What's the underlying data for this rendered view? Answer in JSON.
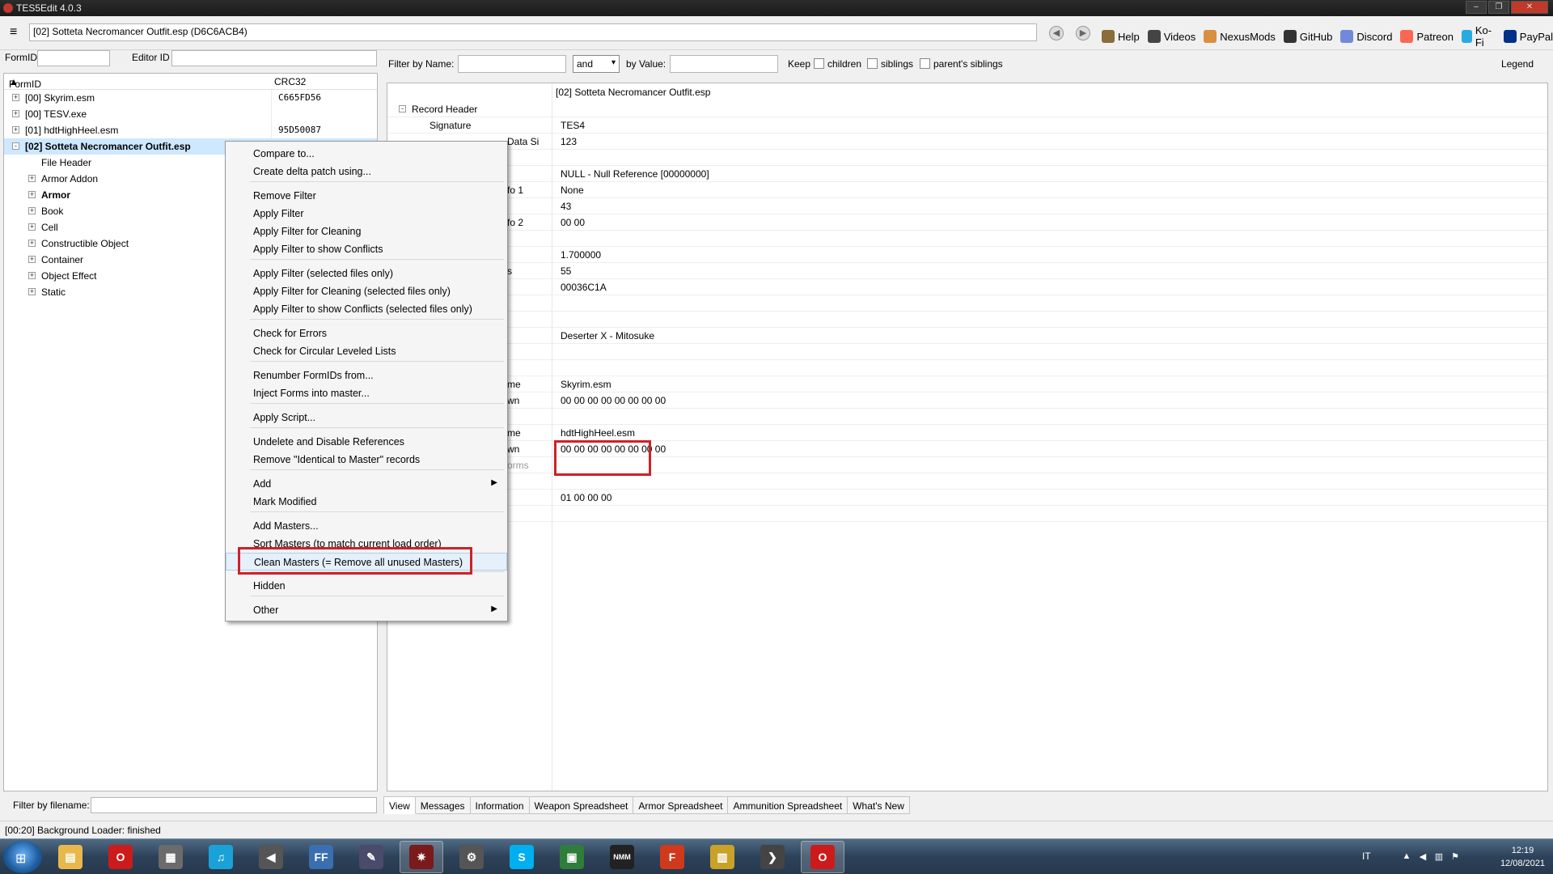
{
  "window": {
    "title": "TES5Edit 4.0.3",
    "file_path": "[02] Sotteta Necromancer Outfit.esp (D6C6ACB4)"
  },
  "toolbar": {
    "links": [
      {
        "label": "Help",
        "icon": "book-icon",
        "color": "#8a6d3b"
      },
      {
        "label": "Videos",
        "icon": "video-icon",
        "color": "#444444"
      },
      {
        "label": "NexusMods",
        "icon": "nexus-icon",
        "color": "#d98f40"
      },
      {
        "label": "GitHub",
        "icon": "github-icon",
        "color": "#333333"
      },
      {
        "label": "Discord",
        "icon": "discord-icon",
        "color": "#7289da"
      },
      {
        "label": "Patreon",
        "icon": "patreon-icon",
        "color": "#f96854"
      },
      {
        "label": "Ko-Fi",
        "icon": "kofi-icon",
        "color": "#29abe0"
      },
      {
        "label": "PayPal",
        "icon": "paypal-icon",
        "color": "#003087"
      }
    ]
  },
  "left": {
    "formid_label": "FormID",
    "editorid_label": "Editor ID",
    "tree_header": {
      "col1": "FormID",
      "col2": "CRC32"
    },
    "tree": [
      {
        "label": "[00] Skyrim.esm",
        "crc": "C665FD56",
        "level": 0,
        "exp": "+"
      },
      {
        "label": "[00] TESV.exe",
        "crc": "",
        "level": 0,
        "exp": "+"
      },
      {
        "label": "[01] hdtHighHeel.esm",
        "crc": "95D50087",
        "level": 0,
        "exp": "+"
      },
      {
        "label": "[02] Sotteta Necromancer Outfit.esp",
        "crc": "",
        "level": 0,
        "exp": "-",
        "selected": true,
        "bold": true
      },
      {
        "label": "File Header",
        "crc": "",
        "level": 1,
        "exp": ""
      },
      {
        "label": "Armor Addon",
        "crc": "",
        "level": 1,
        "exp": "+"
      },
      {
        "label": "Armor",
        "crc": "",
        "level": 1,
        "exp": "+",
        "bold": true
      },
      {
        "label": "Book",
        "crc": "",
        "level": 1,
        "exp": "+"
      },
      {
        "label": "Cell",
        "crc": "",
        "level": 1,
        "exp": "+"
      },
      {
        "label": "Constructible Object",
        "crc": "",
        "level": 1,
        "exp": "+"
      },
      {
        "label": "Container",
        "crc": "",
        "level": 1,
        "exp": "+"
      },
      {
        "label": "Object Effect",
        "crc": "",
        "level": 1,
        "exp": "+"
      },
      {
        "label": "Static",
        "crc": "",
        "level": 1,
        "exp": "+"
      }
    ],
    "filter_filename_label": "Filter by filename:"
  },
  "filter": {
    "by_name_label": "Filter by Name:",
    "operator": "and",
    "by_value_label": "by Value:",
    "keep_label": "Keep",
    "children_label": "children",
    "siblings_label": "siblings",
    "parents_siblings_label": "parent's siblings",
    "legend_label": "Legend"
  },
  "detail": {
    "header": "[02] Sotteta Necromancer Outfit.esp",
    "rows": [
      {
        "key": "Record Header",
        "value": "",
        "exp": "-",
        "indent": 0
      },
      {
        "key": "Signature",
        "value": "TES4",
        "indent": 2
      },
      {
        "key": "Data Si",
        "value": "123",
        "indent": 2
      },
      {
        "key": "",
        "value": "",
        "indent": 2
      },
      {
        "key": "",
        "value": "NULL - Null Reference [00000000]",
        "indent": 2
      },
      {
        "key": "fo 1",
        "value": "None",
        "indent": 2
      },
      {
        "key": "",
        "value": "43",
        "indent": 2
      },
      {
        "key": "fo 2",
        "value": "00 00",
        "indent": 2
      },
      {
        "key": "",
        "value": "",
        "indent": 2
      },
      {
        "key": "",
        "value": "1.700000",
        "indent": 2
      },
      {
        "key": "s",
        "value": "55",
        "indent": 2
      },
      {
        "key": "",
        "value": "00036C1A",
        "indent": 2
      },
      {
        "key": "",
        "value": "",
        "indent": 2
      },
      {
        "key": "",
        "value": "",
        "indent": 2
      },
      {
        "key": "",
        "value": "Deserter X - Mitosuke",
        "indent": 2
      },
      {
        "key": "",
        "value": "",
        "indent": 2
      },
      {
        "key": "",
        "value": "",
        "indent": 2
      },
      {
        "key": "me",
        "value": "Skyrim.esm",
        "indent": 2
      },
      {
        "key": "wn",
        "value": "00 00 00 00 00 00 00 00",
        "indent": 2
      },
      {
        "key": "",
        "value": "",
        "indent": 2
      },
      {
        "key": "me",
        "value": "hdtHighHeel.esm",
        "indent": 2
      },
      {
        "key": "wn",
        "value": "00 00 00 00 00 00 00 00",
        "indent": 2
      },
      {
        "key": "orms",
        "value": "",
        "indent": 2,
        "gray": true
      },
      {
        "key": "",
        "value": "",
        "indent": 2
      },
      {
        "key": "",
        "value": "01 00 00 00",
        "indent": 2
      },
      {
        "key": "",
        "value": "",
        "indent": 2
      }
    ]
  },
  "tabs": [
    "View",
    "Messages",
    "Information",
    "Weapon Spreadsheet",
    "Armor Spreadsheet",
    "Ammunition Spreadsheet",
    "What's New"
  ],
  "status": "[00:20] Background Loader: finished",
  "context_menu": [
    {
      "label": "Compare to..."
    },
    {
      "label": "Create delta patch using..."
    },
    {
      "sep": true
    },
    {
      "label": "Remove Filter"
    },
    {
      "label": "Apply Filter"
    },
    {
      "label": "Apply Filter for Cleaning"
    },
    {
      "label": "Apply Filter to show Conflicts"
    },
    {
      "sep": true
    },
    {
      "label": "Apply Filter (selected files only)"
    },
    {
      "label": "Apply Filter for Cleaning (selected files only)"
    },
    {
      "label": "Apply Filter to show Conflicts (selected files only)"
    },
    {
      "sep": true
    },
    {
      "label": "Check for Errors"
    },
    {
      "label": "Check for Circular Leveled Lists"
    },
    {
      "sep": true
    },
    {
      "label": "Renumber FormIDs from..."
    },
    {
      "label": "Inject Forms into master..."
    },
    {
      "sep": true
    },
    {
      "label": "Apply Script..."
    },
    {
      "sep": true
    },
    {
      "label": "Undelete and Disable References"
    },
    {
      "label": "Remove \"Identical to Master\" records"
    },
    {
      "sep": true
    },
    {
      "label": "Add",
      "submenu": true
    },
    {
      "label": "Mark Modified"
    },
    {
      "sep": true
    },
    {
      "label": "Add Masters..."
    },
    {
      "label": "Sort Masters (to match current load order)"
    },
    {
      "label": "Clean Masters (= Remove all unused Masters)",
      "highlight": true
    },
    {
      "sep": true
    },
    {
      "label": "Hidden"
    },
    {
      "sep": true
    },
    {
      "label": "Other",
      "submenu": true
    }
  ],
  "taskbar": {
    "items": [
      {
        "name": "explorer-icon",
        "color": "#e8b84a",
        "glyph": "▤"
      },
      {
        "name": "opera-icon",
        "color": "#cc1b1b",
        "glyph": "O"
      },
      {
        "name": "media-icon",
        "color": "#6b6b6b",
        "glyph": "▦"
      },
      {
        "name": "music-icon",
        "color": "#1aa2d8",
        "glyph": "♫"
      },
      {
        "name": "speaker-icon",
        "color": "#555555",
        "glyph": "◀"
      },
      {
        "name": "ffdec-icon",
        "color": "#3a6fb0",
        "glyph": "FF"
      },
      {
        "name": "pen-icon",
        "color": "#4a4a6a",
        "glyph": "✎"
      },
      {
        "name": "tes5edit-icon",
        "color": "#7a1a1a",
        "glyph": "✷",
        "active": true
      },
      {
        "name": "settings-icon",
        "color": "#555555",
        "glyph": "⚙"
      },
      {
        "name": "skype-icon",
        "color": "#00aff0",
        "glyph": "S"
      },
      {
        "name": "window-icon",
        "color": "#2f7d3a",
        "glyph": "▣"
      },
      {
        "name": "nmm-icon",
        "color": "#222222",
        "glyph": "NMM"
      },
      {
        "name": "f-icon",
        "color": "#d0391b",
        "glyph": "F"
      },
      {
        "name": "archive-icon",
        "color": "#c9a227",
        "glyph": "▥"
      },
      {
        "name": "terminal-icon",
        "color": "#444444",
        "glyph": "❯"
      },
      {
        "name": "opera-active-icon",
        "color": "#cc1b1b",
        "glyph": "O",
        "active": true
      }
    ],
    "lang": "IT",
    "time": "12:19",
    "date": "12/08/2021"
  }
}
